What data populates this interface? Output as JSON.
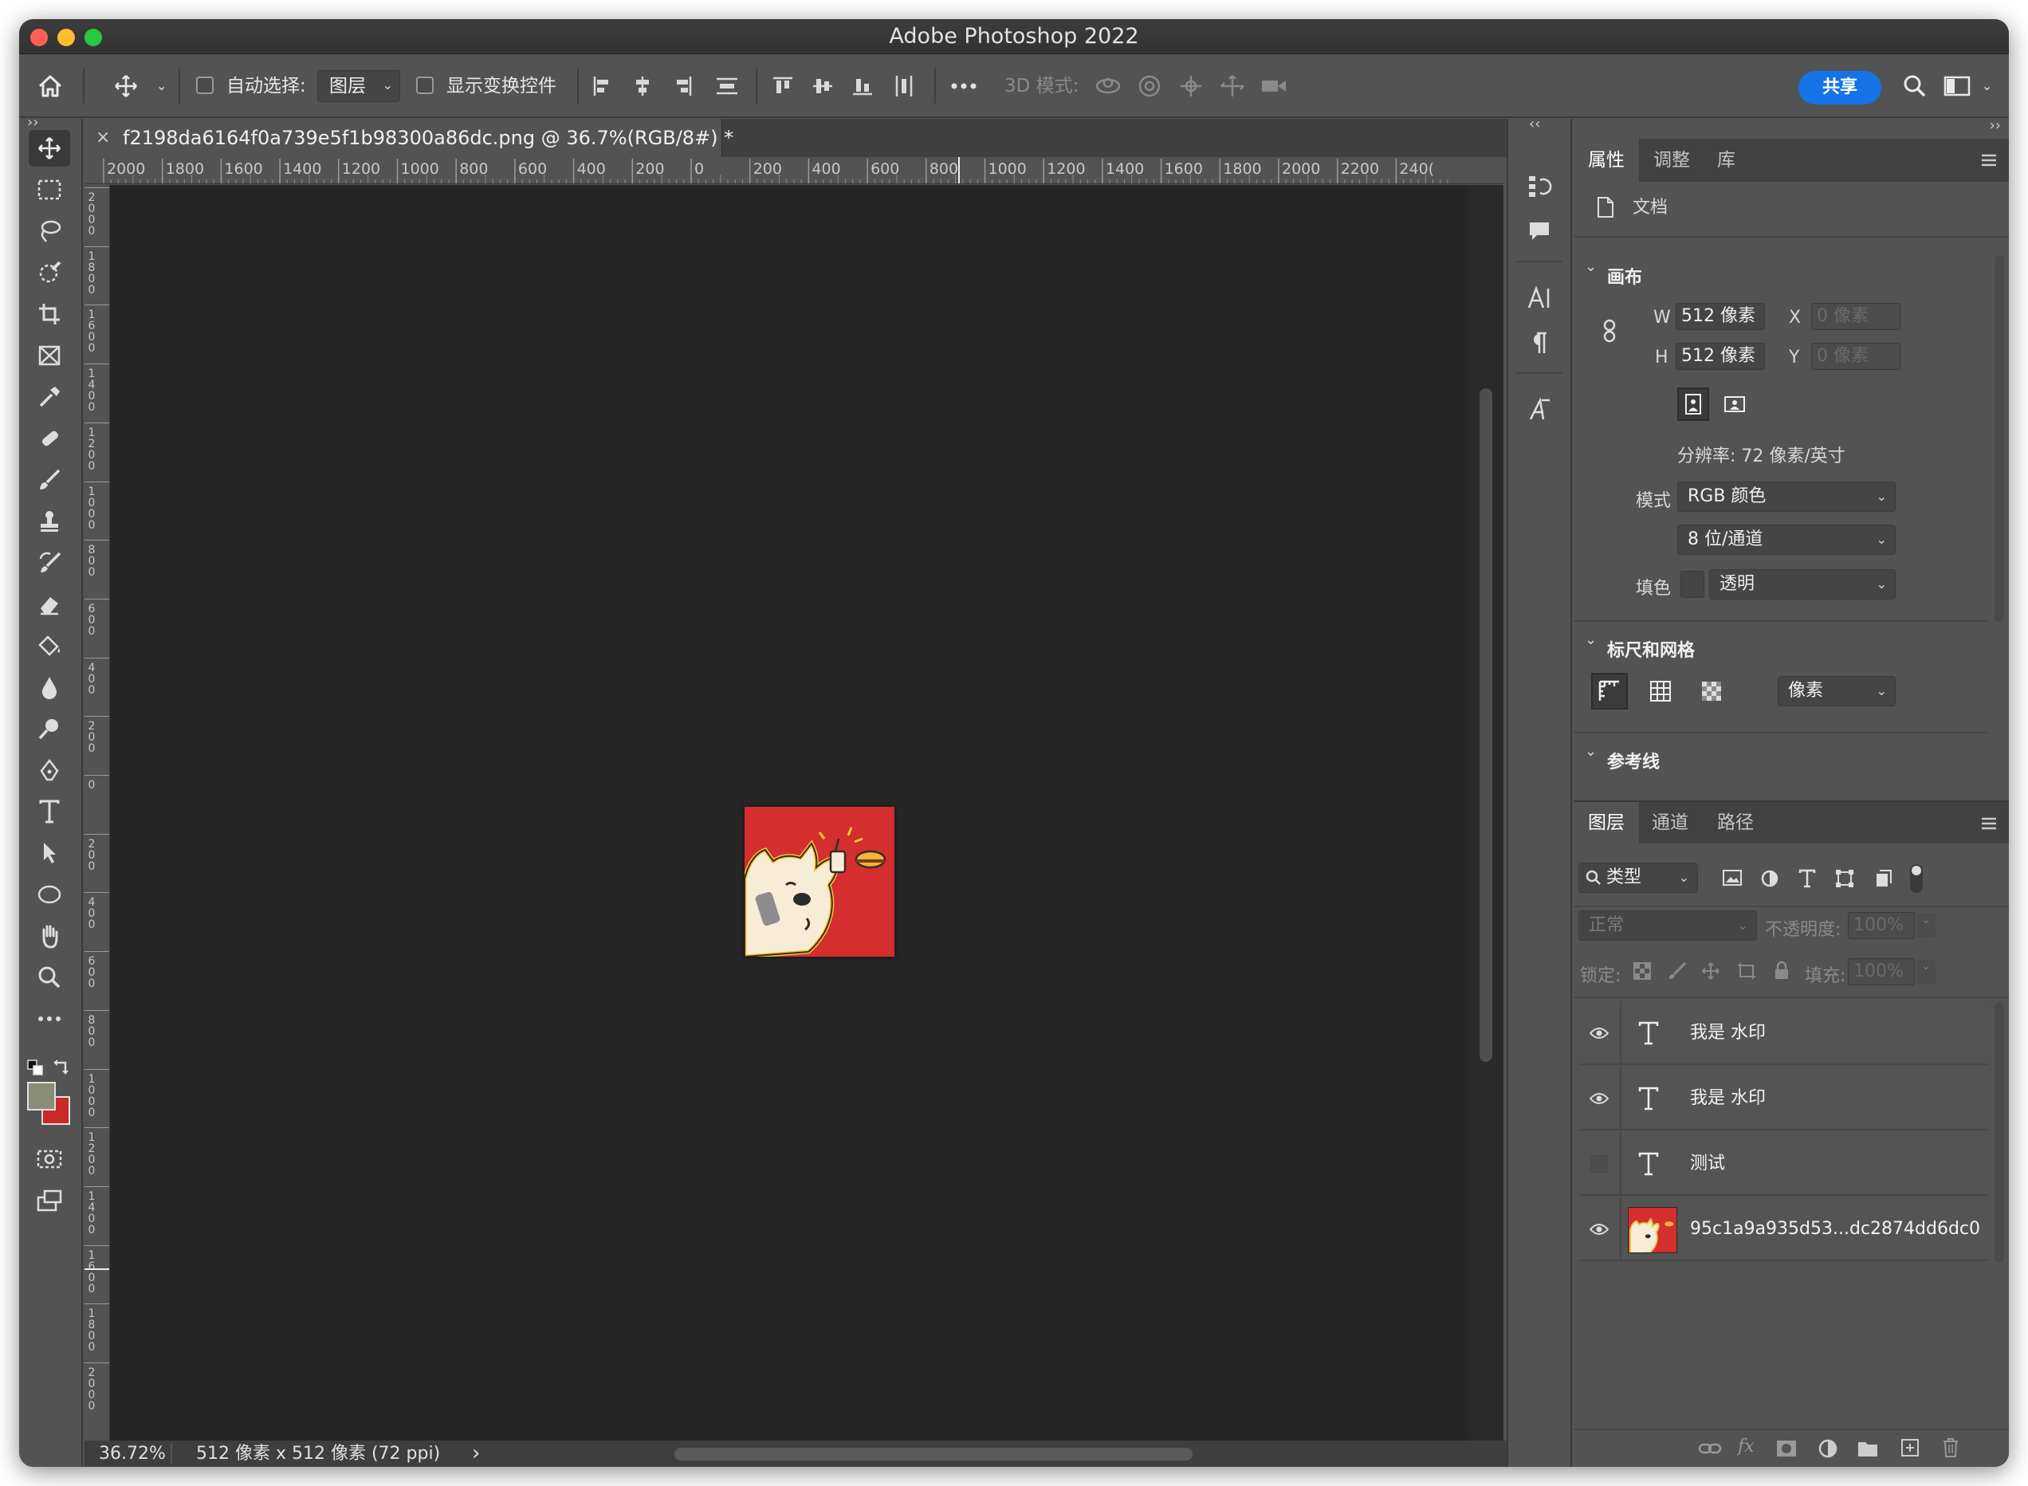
{
  "window": {
    "title": "Adobe Photoshop 2022",
    "traffic_lights": [
      "#ff5f57",
      "#febc2e",
      "#28c840"
    ]
  },
  "options_bar": {
    "auto_select_label": "自动选择:",
    "auto_select_value": "图层",
    "show_transform_label": "显示变换控件",
    "mode_3d_label": "3D 模式:",
    "share_button": "共享"
  },
  "document": {
    "tab_title": "f2198da6164f0a739e5f1b98300a86dc.png @ 36.7%(RGB/8#) *",
    "ruler_labels": [
      "2000",
      "1800",
      "1600",
      "1400",
      "1200",
      "1000",
      "800",
      "600",
      "400",
      "200",
      "0",
      "200",
      "400",
      "600",
      "800",
      "1000",
      "1200",
      "1400",
      "1600",
      "1800",
      "2000",
      "2200",
      "240("
    ],
    "vruler_labels": [
      "2000",
      "1800",
      "1600",
      "1400",
      "1200",
      "1000",
      "800",
      "600",
      "400",
      "200",
      "0",
      "200",
      "400",
      "600",
      "800",
      "1000",
      "1200",
      "1400",
      "1600",
      "1800",
      "2000"
    ],
    "canvas_bg": "#d42e2e",
    "status_zoom": "36.72%",
    "status_info": "512 像素 x 512 像素 (72 ppi)",
    "status_arrow": "›"
  },
  "properties": {
    "tabs": [
      "属性",
      "调整",
      "库"
    ],
    "doc_label": "文档",
    "canvas_section": "画布",
    "w_label": "W",
    "h_label": "H",
    "x_label": "X",
    "y_label": "Y",
    "w_value": "512 像素",
    "h_value": "512 像素",
    "x_value": "0 像素",
    "y_value": "0 像素",
    "resolution": "分辨率: 72 像素/英寸",
    "mode_label": "模式",
    "mode_value": "RGB 颜色",
    "bit_value": "8 位/通道",
    "fill_label": "填色",
    "fill_value": "透明",
    "rulers_section": "标尺和网格",
    "units_value": "像素",
    "guides_section": "参考线"
  },
  "layers_panel": {
    "tabs": [
      "图层",
      "通道",
      "路径"
    ],
    "filter_value": "类型",
    "blend_mode": "正常",
    "opacity_label": "不透明度:",
    "opacity_value": "100%",
    "lock_label": "锁定:",
    "fill_label": "填充:",
    "fill_value": "100%",
    "layers": [
      {
        "name": "我是 水印",
        "type": "text",
        "visible": true
      },
      {
        "name": "我是 水印",
        "type": "text",
        "visible": true
      },
      {
        "name": "测试",
        "type": "text",
        "visible": false
      },
      {
        "name": "95c1a9a935d53...dc2874dd6dc0",
        "type": "image",
        "visible": true
      }
    ]
  },
  "colors": {
    "foreground": "#8a8d76",
    "background": "#c8292b",
    "share_blue": "#1473e6"
  }
}
